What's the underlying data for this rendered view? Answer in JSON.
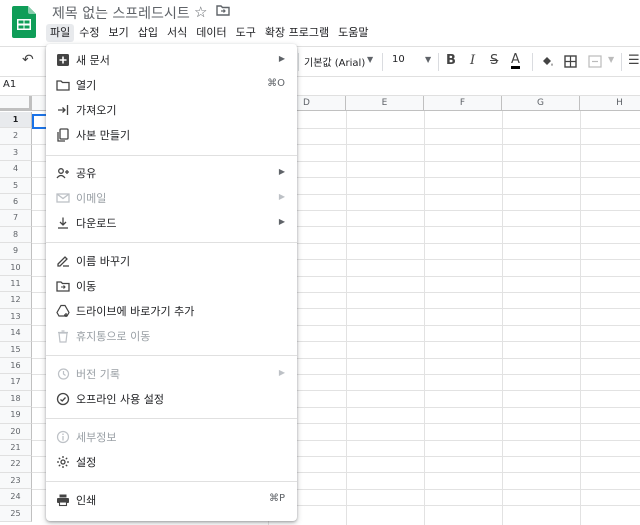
{
  "app": {
    "doc_title": "제목 없는 스프레드시트",
    "menubar": [
      "파일",
      "수정",
      "보기",
      "삽입",
      "서식",
      "데이터",
      "도구",
      "확장 프로그램",
      "도움말"
    ]
  },
  "toolbar": {
    "font_name": "기본값 (Arial)",
    "font_size": "10"
  },
  "formula_bar": {
    "name_box": "A1"
  },
  "grid": {
    "columns": [
      "D",
      "E",
      "F",
      "G",
      "H"
    ],
    "rows": [
      "1",
      "2",
      "3",
      "4",
      "5",
      "6",
      "7",
      "8",
      "9",
      "10",
      "11",
      "12",
      "13",
      "14",
      "15",
      "16",
      "17",
      "18",
      "19",
      "20",
      "21",
      "22",
      "23",
      "24",
      "25"
    ],
    "selected_cell": "A1"
  },
  "file_menu": {
    "new": "새 문서",
    "open": "열기",
    "open_shortcut": "⌘O",
    "import": "가져오기",
    "make_copy": "사본 만들기",
    "share": "공유",
    "email": "이메일",
    "download": "다운로드",
    "rename": "이름 바꾸기",
    "move": "이동",
    "add_shortcut": "드라이브에 바로가기 추가",
    "move_to_trash": "휴지통으로 이동",
    "version_history": "버전 기록",
    "offline": "오프라인 사용 설정",
    "details": "세부정보",
    "settings": "설정",
    "print": "인쇄",
    "print_shortcut": "⌘P"
  },
  "colors": {
    "sheets_green": "#0f9d58",
    "selection_blue": "#1a73e8",
    "disabled_text": "#9aa0a6"
  },
  "icons": [
    "sheets-logo-icon",
    "star-icon",
    "move-folder-icon",
    "undo-icon",
    "bold-icon",
    "italic-icon",
    "strikethrough-icon",
    "text-color-icon",
    "fill-color-icon",
    "borders-icon",
    "merge-icon",
    "align-icon"
  ]
}
